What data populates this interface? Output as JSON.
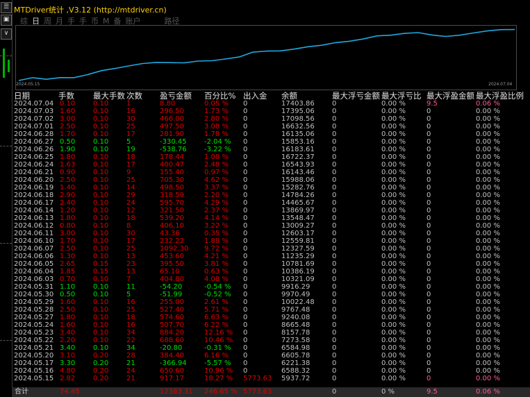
{
  "window": {
    "title": "MTDriver统计 ,V3.12 (http://mtdriver.cn)"
  },
  "tabs": [
    {
      "label": "综",
      "active": false
    },
    {
      "label": "日",
      "active": true
    },
    {
      "label": "周",
      "active": false
    },
    {
      "label": "月",
      "active": false
    },
    {
      "label": "手",
      "active": false
    },
    {
      "label": "手",
      "active": false
    },
    {
      "label": "币",
      "active": false
    },
    {
      "label": "M",
      "active": false
    },
    {
      "label": "备",
      "active": false
    },
    {
      "label": "账户",
      "active": false
    },
    {
      "label": "路径",
      "active": false
    }
  ],
  "chart_data": {
    "type": "line",
    "x_start_label": "2024.05.15",
    "x_end_label": "2024.07.04",
    "x": [
      "2024.05.15",
      "2024.05.16",
      "2024.05.17",
      "2024.05.20",
      "2024.05.21",
      "2024.05.22",
      "2024.05.23",
      "2024.05.24",
      "2024.05.27",
      "2024.05.28",
      "2024.05.29",
      "2024.05.30",
      "2024.05.31",
      "2024.06.03",
      "2024.06.04",
      "2024.06.05",
      "2024.06.06",
      "2024.06.07",
      "2024.06.10",
      "2024.06.11",
      "2024.06.12",
      "2024.06.13",
      "2024.06.14",
      "2024.06.17",
      "2024.06.18",
      "2024.06.19",
      "2024.06.20",
      "2024.06.21",
      "2024.06.24",
      "2024.06.25",
      "2024.06.26",
      "2024.06.27",
      "2024.06.28",
      "2024.07.01",
      "2024.07.02",
      "2024.07.03",
      "2024.07.04"
    ],
    "series": [
      {
        "values": [
          5937.72,
          6588.32,
          6221.38,
          6605.78,
          6584.98,
          7273.58,
          8157.78,
          8665.48,
          9240.08,
          9767.48,
          10022.48,
          9970.49,
          9916.29,
          10321.09,
          10386.19,
          10781.69,
          11235.29,
          12327.59,
          12559.81,
          12603.17,
          13009.27,
          13548.47,
          13869.97,
          14465.67,
          14784.26,
          15282.76,
          15988.06,
          16143.46,
          16543.93,
          16722.37,
          16183.61,
          15853.16,
          16135.06,
          16632.56,
          17098.56,
          17395.06,
          17403.86
        ]
      }
    ],
    "line_color": "#20a8e0"
  },
  "table": {
    "headers": [
      "日期",
      "手数",
      "最大手数",
      "次数",
      "盈亏金额",
      "百分比%",
      "出入金",
      "余额",
      "最大浮亏金额",
      "最大浮亏比",
      "最大浮盈金额",
      "最大浮盈比例"
    ],
    "rows": [
      {
        "date": "2024.07.04",
        "lot": "0.10",
        "maxlot": "0.10",
        "cnt": "1",
        "pl": "8.80",
        "pct": "0.05 %",
        "io": "0",
        "bal": "17403.86",
        "mfl": "0",
        "mflp": "0.00 %",
        "mfp": "9.5",
        "mfpp": "0.06 %",
        "sign": "pos",
        "hl": true
      },
      {
        "date": "2024.07.03",
        "lot": "1.60",
        "maxlot": "0.10",
        "cnt": "16",
        "pl": "296.50",
        "pct": "1.73 %",
        "io": "0",
        "bal": "17395.06",
        "mfl": "0",
        "mflp": "0.00 %",
        "mfp": "0",
        "mfpp": "0.00 %",
        "sign": "pos"
      },
      {
        "date": "2024.07.02",
        "lot": "3.00",
        "maxlot": "0.10",
        "cnt": "30",
        "pl": "466.00",
        "pct": "2.80 %",
        "io": "0",
        "bal": "17098.56",
        "mfl": "0",
        "mflp": "0.00 %",
        "mfp": "0",
        "mfpp": "0.00 %",
        "sign": "pos"
      },
      {
        "date": "2024.07.01",
        "lot": "2.50",
        "maxlot": "0.10",
        "cnt": "25",
        "pl": "497.50",
        "pct": "3.08 %",
        "io": "0",
        "bal": "16632.56",
        "mfl": "0",
        "mflp": "0.00 %",
        "mfp": "0",
        "mfpp": "0.00 %",
        "sign": "pos"
      },
      {
        "date": "2024.06.28",
        "lot": "1.70",
        "maxlot": "0.10",
        "cnt": "17",
        "pl": "281.90",
        "pct": "1.78 %",
        "io": "0",
        "bal": "16135.06",
        "mfl": "0",
        "mflp": "0.00 %",
        "mfp": "0",
        "mfpp": "0.00 %",
        "sign": "pos"
      },
      {
        "date": "2024.06.27",
        "lot": "0.50",
        "maxlot": "0.10",
        "cnt": "5",
        "pl": "-330.45",
        "pct": "-2.04 %",
        "io": "0",
        "bal": "15853.16",
        "mfl": "0",
        "mflp": "0.00 %",
        "mfp": "0",
        "mfpp": "0.00 %",
        "sign": "neg"
      },
      {
        "date": "2024.06.26",
        "lot": "1.90",
        "maxlot": "0.10",
        "cnt": "19",
        "pl": "-538.76",
        "pct": "-3.22 %",
        "io": "0",
        "bal": "16183.61",
        "mfl": "0",
        "mflp": "0.00 %",
        "mfp": "0",
        "mfpp": "0.00 %",
        "sign": "neg"
      },
      {
        "date": "2024.06.25",
        "lot": "1.80",
        "maxlot": "0.10",
        "cnt": "18",
        "pl": "178.44",
        "pct": "1.08 %",
        "io": "0",
        "bal": "16722.37",
        "mfl": "0",
        "mflp": "0.00 %",
        "mfp": "0",
        "mfpp": "0.00 %",
        "sign": "pos"
      },
      {
        "date": "2024.06.24",
        "lot": "1.63",
        "maxlot": "0.10",
        "cnt": "17",
        "pl": "400.47",
        "pct": "2.48 %",
        "io": "0",
        "bal": "16543.93",
        "mfl": "0",
        "mflp": "0.00 %",
        "mfp": "0",
        "mfpp": "0.00 %",
        "sign": "pos"
      },
      {
        "date": "2024.06.21",
        "lot": "0.90",
        "maxlot": "0.10",
        "cnt": "9",
        "pl": "155.40",
        "pct": "0.97 %",
        "io": "0",
        "bal": "16143.46",
        "mfl": "0",
        "mflp": "0.00 %",
        "mfp": "0",
        "mfpp": "0.00 %",
        "sign": "pos"
      },
      {
        "date": "2024.06.20",
        "lot": "2.50",
        "maxlot": "0.10",
        "cnt": "25",
        "pl": "705.30",
        "pct": "4.62 %",
        "io": "0",
        "bal": "15988.06",
        "mfl": "0",
        "mflp": "0.00 %",
        "mfp": "0",
        "mfpp": "0.00 %",
        "sign": "pos"
      },
      {
        "date": "2024.06.19",
        "lot": "1.40",
        "maxlot": "0.10",
        "cnt": "14",
        "pl": "498.50",
        "pct": "3.37 %",
        "io": "0",
        "bal": "15282.76",
        "mfl": "0",
        "mflp": "0.00 %",
        "mfp": "0",
        "mfpp": "0.00 %",
        "sign": "pos"
      },
      {
        "date": "2024.06.18",
        "lot": "2.90",
        "maxlot": "0.10",
        "cnt": "29",
        "pl": "318.59",
        "pct": "2.20 %",
        "io": "0",
        "bal": "14784.26",
        "mfl": "0",
        "mflp": "0.00 %",
        "mfp": "0",
        "mfpp": "0.00 %",
        "sign": "pos"
      },
      {
        "date": "2024.06.17",
        "lot": "2.40",
        "maxlot": "0.10",
        "cnt": "24",
        "pl": "595.70",
        "pct": "4.29 %",
        "io": "0",
        "bal": "14465.67",
        "mfl": "0",
        "mflp": "0.00 %",
        "mfp": "0",
        "mfpp": "0.00 %",
        "sign": "pos"
      },
      {
        "date": "2024.06.14",
        "lot": "1.20",
        "maxlot": "0.10",
        "cnt": "12",
        "pl": "321.50",
        "pct": "2.37 %",
        "io": "0",
        "bal": "13869.97",
        "mfl": "0",
        "mflp": "0.00 %",
        "mfp": "0",
        "mfpp": "0.00 %",
        "sign": "pos"
      },
      {
        "date": "2024.06.13",
        "lot": "1.80",
        "maxlot": "0.10",
        "cnt": "18",
        "pl": "539.20",
        "pct": "4.14 %",
        "io": "0",
        "bal": "13548.47",
        "mfl": "0",
        "mflp": "0.00 %",
        "mfp": "0",
        "mfpp": "0.00 %",
        "sign": "pos"
      },
      {
        "date": "2024.06.12",
        "lot": "0.80",
        "maxlot": "0.10",
        "cnt": "8",
        "pl": "406.10",
        "pct": "3.22 %",
        "io": "0",
        "bal": "13009.27",
        "mfl": "0",
        "mflp": "0.00 %",
        "mfp": "0",
        "mfpp": "0.00 %",
        "sign": "pos"
      },
      {
        "date": "2024.06.11",
        "lot": "3.00",
        "maxlot": "0.10",
        "cnt": "30",
        "pl": "43.36",
        "pct": "0.35 %",
        "io": "0",
        "bal": "12603.17",
        "mfl": "0",
        "mflp": "0.00 %",
        "mfp": "0",
        "mfpp": "0.00 %",
        "sign": "pos"
      },
      {
        "date": "2024.06.10",
        "lot": "1.70",
        "maxlot": "0.10",
        "cnt": "17",
        "pl": "232.22",
        "pct": "1.88 %",
        "io": "0",
        "bal": "12559.81",
        "mfl": "0",
        "mflp": "0.00 %",
        "mfp": "0",
        "mfpp": "0.00 %",
        "sign": "pos"
      },
      {
        "date": "2024.06.07",
        "lot": "2.50",
        "maxlot": "0.10",
        "cnt": "25",
        "pl": "1092.30",
        "pct": "9.72 %",
        "io": "0",
        "bal": "12327.59",
        "mfl": "0",
        "mflp": "0.00 %",
        "mfp": "0",
        "mfpp": "0.00 %",
        "sign": "pos"
      },
      {
        "date": "2024.06.06",
        "lot": "1.30",
        "maxlot": "0.10",
        "cnt": "13",
        "pl": "453.60",
        "pct": "4.21 %",
        "io": "0",
        "bal": "11235.29",
        "mfl": "0",
        "mflp": "0.00 %",
        "mfp": "0",
        "mfpp": "0.00 %",
        "sign": "pos"
      },
      {
        "date": "2024.06.05",
        "lot": "2.65",
        "maxlot": "0.15",
        "cnt": "23",
        "pl": "395.50",
        "pct": "3.81 %",
        "io": "0",
        "bal": "10781.69",
        "mfl": "0",
        "mflp": "0.00 %",
        "mfp": "0",
        "mfpp": "0.00 %",
        "sign": "pos"
      },
      {
        "date": "2024.06.04",
        "lot": "1.85",
        "maxlot": "0.15",
        "cnt": "13",
        "pl": "65.10",
        "pct": "0.63 %",
        "io": "0",
        "bal": "10386.19",
        "mfl": "0",
        "mflp": "0.00 %",
        "mfp": "0",
        "mfpp": "0.00 %",
        "sign": "pos"
      },
      {
        "date": "2024.06.03",
        "lot": "0.70",
        "maxlot": "0.10",
        "cnt": "7",
        "pl": "404.80",
        "pct": "4.08 %",
        "io": "0",
        "bal": "10321.09",
        "mfl": "0",
        "mflp": "0.00 %",
        "mfp": "0",
        "mfpp": "0.00 %",
        "sign": "pos"
      },
      {
        "date": "2024.05.31",
        "lot": "1.10",
        "maxlot": "0.10",
        "cnt": "11",
        "pl": "-54.20",
        "pct": "-0.54 %",
        "io": "0",
        "bal": "9916.29",
        "mfl": "0",
        "mflp": "0.00 %",
        "mfp": "0",
        "mfpp": "0.00 %",
        "sign": "neg"
      },
      {
        "date": "2024.05.30",
        "lot": "0.50",
        "maxlot": "0.10",
        "cnt": "5",
        "pl": "-51.99",
        "pct": "-0.52 %",
        "io": "0",
        "bal": "9970.49",
        "mfl": "0",
        "mflp": "0.00 %",
        "mfp": "0",
        "mfpp": "0.00 %",
        "sign": "neg"
      },
      {
        "date": "2024.05.29",
        "lot": "1.60",
        "maxlot": "0.10",
        "cnt": "16",
        "pl": "255.00",
        "pct": "2.61 %",
        "io": "0",
        "bal": "10022.48",
        "mfl": "0",
        "mflp": "0.00 %",
        "mfp": "0",
        "mfpp": "0.00 %",
        "sign": "pos"
      },
      {
        "date": "2024.05.28",
        "lot": "2.50",
        "maxlot": "0.10",
        "cnt": "25",
        "pl": "527.40",
        "pct": "5.71 %",
        "io": "0",
        "bal": "9767.48",
        "mfl": "0",
        "mflp": "0.00 %",
        "mfp": "0",
        "mfpp": "0.00 %",
        "sign": "pos"
      },
      {
        "date": "2024.05.27",
        "lot": "1.80",
        "maxlot": "0.10",
        "cnt": "18",
        "pl": "574.60",
        "pct": "6.63 %",
        "io": "0",
        "bal": "9240.08",
        "mfl": "0",
        "mflp": "0.00 %",
        "mfp": "0",
        "mfpp": "0.00 %",
        "sign": "pos"
      },
      {
        "date": "2024.05.24",
        "lot": "1.60",
        "maxlot": "0.10",
        "cnt": "16",
        "pl": "507.70",
        "pct": "6.22 %",
        "io": "0",
        "bal": "8665.48",
        "mfl": "0",
        "mflp": "0.00 %",
        "mfp": "0",
        "mfpp": "0.00 %",
        "sign": "pos"
      },
      {
        "date": "2024.05.23",
        "lot": "3.40",
        "maxlot": "0.10",
        "cnt": "34",
        "pl": "884.20",
        "pct": "12.16 %",
        "io": "0",
        "bal": "8157.78",
        "mfl": "0",
        "mflp": "0.00 %",
        "mfp": "0",
        "mfpp": "0.00 %",
        "sign": "pos"
      },
      {
        "date": "2024.05.22",
        "lot": "2.20",
        "maxlot": "0.10",
        "cnt": "22",
        "pl": "688.60",
        "pct": "10.46 %",
        "io": "0",
        "bal": "7273.58",
        "mfl": "0",
        "mflp": "0.00 %",
        "mfp": "0",
        "mfpp": "0.00 %",
        "sign": "pos"
      },
      {
        "date": "2024.05.21",
        "lot": "3.40",
        "maxlot": "0.10",
        "cnt": "34",
        "pl": "-20.80",
        "pct": "-0.31 %",
        "io": "0",
        "bal": "6584.98",
        "mfl": "0",
        "mflp": "0.00 %",
        "mfp": "0",
        "mfpp": "0.00 %",
        "sign": "neg"
      },
      {
        "date": "2024.05.20",
        "lot": "3.10",
        "maxlot": "0.20",
        "cnt": "28",
        "pl": "384.40",
        "pct": "6.16 %",
        "io": "0",
        "bal": "6605.78",
        "mfl": "0",
        "mflp": "0.00 %",
        "mfp": "0",
        "mfpp": "0.00 %",
        "sign": "pos"
      },
      {
        "date": "2024.05.17",
        "lot": "3.30",
        "maxlot": "0.20",
        "cnt": "21",
        "pl": "-366.94",
        "pct": "-5.57 %",
        "io": "0",
        "bal": "6221.38",
        "mfl": "0",
        "mflp": "0.00 %",
        "mfp": "0",
        "mfpp": "0.00 %",
        "sign": "neg"
      },
      {
        "date": "2024.05.16",
        "lot": "4.80",
        "maxlot": "0.20",
        "cnt": "24",
        "pl": "650.60",
        "pct": "10.96 %",
        "io": "0",
        "bal": "6588.32",
        "mfl": "0",
        "mflp": "0.00 %",
        "mfp": "0",
        "mfpp": "0.00 %",
        "sign": "pos"
      },
      {
        "date": "2024.05.15",
        "lot": "2.82",
        "maxlot": "0.20",
        "cnt": "21",
        "pl": "917.17",
        "pct": "18.27 %",
        "io": "5773.63",
        "bal": "5937.72",
        "mfl": "0",
        "mflp": "0.00 %",
        "mfp": "0",
        "mfpp": "0.00 %",
        "sign": "pos",
        "hl": true
      }
    ],
    "total": {
      "label": "合计",
      "lot": "74.45",
      "pl": "12383.31",
      "pct": "246.65 %",
      "io": "5773.63",
      "mfl": "0",
      "mflp": "0 %",
      "mfp": "9.5",
      "mfpp": "0.06 %"
    }
  },
  "colors": {
    "positive": "#e00000",
    "negative": "#00e000",
    "title": "#ffd200",
    "highlight": "#ff5a8a"
  }
}
